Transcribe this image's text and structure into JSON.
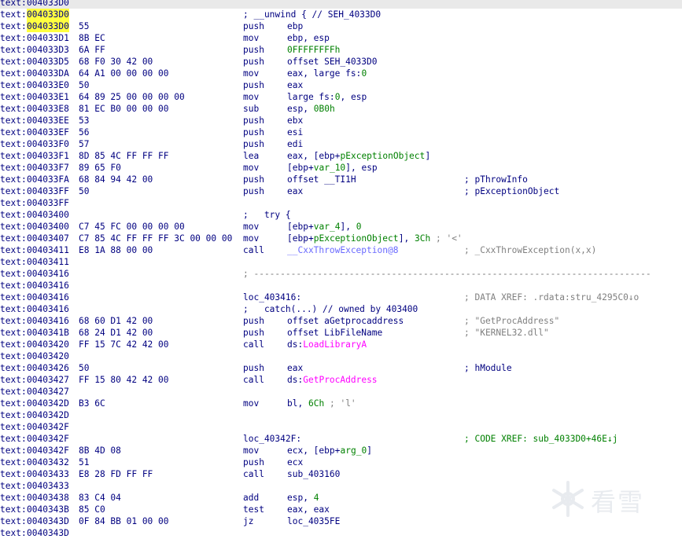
{
  "lines": [
    {
      "seg": "text:",
      "addr": "004033D0",
      "bytes": "",
      "dis": [],
      "right": [],
      "hl": true,
      "mark": false
    },
    {
      "seg": "text:",
      "addr": "004033D0",
      "bytes": "",
      "dis": [
        {
          "t": "; __unwind { // SEH_4033D0",
          "c": "c-mn"
        }
      ],
      "right": [],
      "hl": false,
      "mark": true
    },
    {
      "seg": "text:",
      "addr": "004033D0",
      "bytes": "55",
      "dis": [
        {
          "t": "push",
          "c": "c-mn"
        },
        {
          "t": "ebp",
          "c": "c-op",
          "o": true
        }
      ],
      "right": [],
      "hl": false,
      "mark": true
    },
    {
      "seg": "text:",
      "addr": "004033D1",
      "bytes": "8B EC",
      "dis": [
        {
          "t": "mov",
          "c": "c-mn"
        },
        {
          "t": "ebp, esp",
          "c": "c-op",
          "o": true
        }
      ],
      "right": [],
      "hl": false,
      "mark": false
    },
    {
      "seg": "text:",
      "addr": "004033D3",
      "bytes": "6A FF",
      "dis": [
        {
          "t": "push",
          "c": "c-mn"
        },
        {
          "t": "0FFFFFFFFh",
          "c": "c-num",
          "o": true
        }
      ],
      "right": [],
      "hl": false,
      "mark": false
    },
    {
      "seg": "text:",
      "addr": "004033D5",
      "bytes": "68 F0 30 42 00",
      "dis": [
        {
          "t": "push",
          "c": "c-mn"
        },
        {
          "t": "offset SEH_4033D0",
          "c": "c-op",
          "o": true
        }
      ],
      "right": [],
      "hl": false,
      "mark": false
    },
    {
      "seg": "text:",
      "addr": "004033DA",
      "bytes": "64 A1 00 00 00 00",
      "dis": [
        {
          "t": "mov",
          "c": "c-mn"
        },
        {
          "t": "eax, large fs:",
          "c": "c-op",
          "o": true
        },
        {
          "t": "0",
          "c": "c-num"
        }
      ],
      "right": [],
      "hl": false,
      "mark": false
    },
    {
      "seg": "text:",
      "addr": "004033E0",
      "bytes": "50",
      "dis": [
        {
          "t": "push",
          "c": "c-mn"
        },
        {
          "t": "eax",
          "c": "c-op",
          "o": true
        }
      ],
      "right": [],
      "hl": false,
      "mark": false
    },
    {
      "seg": "text:",
      "addr": "004033E1",
      "bytes": "64 89 25 00 00 00 00",
      "dis": [
        {
          "t": "mov",
          "c": "c-mn"
        },
        {
          "t": "large fs:",
          "c": "c-op",
          "o": true
        },
        {
          "t": "0",
          "c": "c-num"
        },
        {
          "t": ", esp",
          "c": "c-op"
        }
      ],
      "right": [],
      "hl": false,
      "mark": false
    },
    {
      "seg": "text:",
      "addr": "004033E8",
      "bytes": "81 EC B0 00 00 00",
      "dis": [
        {
          "t": "sub",
          "c": "c-mn"
        },
        {
          "t": "esp, ",
          "c": "c-op",
          "o": true
        },
        {
          "t": "0B0h",
          "c": "c-num"
        }
      ],
      "right": [],
      "hl": false,
      "mark": false
    },
    {
      "seg": "text:",
      "addr": "004033EE",
      "bytes": "53",
      "dis": [
        {
          "t": "push",
          "c": "c-mn"
        },
        {
          "t": "ebx",
          "c": "c-op",
          "o": true
        }
      ],
      "right": [],
      "hl": false,
      "mark": false
    },
    {
      "seg": "text:",
      "addr": "004033EF",
      "bytes": "56",
      "dis": [
        {
          "t": "push",
          "c": "c-mn"
        },
        {
          "t": "esi",
          "c": "c-op",
          "o": true
        }
      ],
      "right": [],
      "hl": false,
      "mark": false
    },
    {
      "seg": "text:",
      "addr": "004033F0",
      "bytes": "57",
      "dis": [
        {
          "t": "push",
          "c": "c-mn"
        },
        {
          "t": "edi",
          "c": "c-op",
          "o": true
        }
      ],
      "right": [],
      "hl": false,
      "mark": false
    },
    {
      "seg": "text:",
      "addr": "004033F1",
      "bytes": "8D 85 4C FF FF FF",
      "dis": [
        {
          "t": "lea",
          "c": "c-mn"
        },
        {
          "t": "eax, [ebp+",
          "c": "c-op",
          "o": true
        },
        {
          "t": "pExceptionObject",
          "c": "c-var"
        },
        {
          "t": "]",
          "c": "c-op"
        }
      ],
      "right": [],
      "hl": false,
      "mark": false
    },
    {
      "seg": "text:",
      "addr": "004033F7",
      "bytes": "89 65 F0",
      "dis": [
        {
          "t": "mov",
          "c": "c-mn"
        },
        {
          "t": "[ebp+",
          "c": "c-op",
          "o": true
        },
        {
          "t": "var_10",
          "c": "c-var"
        },
        {
          "t": "], esp",
          "c": "c-op"
        }
      ],
      "right": [],
      "hl": false,
      "mark": false
    },
    {
      "seg": "text:",
      "addr": "004033FA",
      "bytes": "68 84 94 42 00",
      "dis": [
        {
          "t": "push",
          "c": "c-mn"
        },
        {
          "t": "offset __TI1H",
          "c": "c-op",
          "o": true
        }
      ],
      "right": [
        {
          "t": "; pThrowInfo",
          "c": "c-xref"
        }
      ],
      "hl": false,
      "mark": false
    },
    {
      "seg": "text:",
      "addr": "004033FF",
      "bytes": "50",
      "dis": [
        {
          "t": "push",
          "c": "c-mn"
        },
        {
          "t": "eax",
          "c": "c-op",
          "o": true
        }
      ],
      "right": [
        {
          "t": "; pExceptionObject",
          "c": "c-xref"
        }
      ],
      "hl": false,
      "mark": false
    },
    {
      "seg": "text:",
      "addr": "004033FF",
      "bytes": "",
      "dis": [],
      "right": [],
      "hl": false,
      "mark": false
    },
    {
      "seg": "text:",
      "addr": "00403400",
      "bytes": "",
      "dis": [
        {
          "t": ";   try {",
          "c": "c-kw"
        }
      ],
      "right": [],
      "hl": false,
      "mark": false
    },
    {
      "seg": "text:",
      "addr": "00403400",
      "bytes": "C7 45 FC 00 00 00 00",
      "dis": [
        {
          "t": "mov",
          "c": "c-mn"
        },
        {
          "t": "[ebp+",
          "c": "c-op",
          "o": true
        },
        {
          "t": "var_4",
          "c": "c-var"
        },
        {
          "t": "], ",
          "c": "c-op"
        },
        {
          "t": "0",
          "c": "c-num"
        }
      ],
      "right": [],
      "hl": false,
      "mark": false
    },
    {
      "seg": "text:",
      "addr": "00403407",
      "bytes": "C7 85 4C FF FF FF 3C 00 00 00",
      "dis": [
        {
          "t": "mov",
          "c": "c-mn"
        },
        {
          "t": "[ebp+",
          "c": "c-op",
          "o": true
        },
        {
          "t": "pExceptionObject",
          "c": "c-var"
        },
        {
          "t": "], ",
          "c": "c-op"
        },
        {
          "t": "3Ch",
          "c": "c-num"
        },
        {
          "t": " ; '<'",
          "c": "c-cmt"
        }
      ],
      "right": [],
      "hl": false,
      "mark": false
    },
    {
      "seg": "text:",
      "addr": "00403411",
      "bytes": "E8 1A 88 00 00",
      "dis": [
        {
          "t": "call",
          "c": "c-mn"
        },
        {
          "t": "__CxxThrowException@8",
          "c": "c-ext",
          "o": true
        }
      ],
      "right": [
        {
          "t": "; _CxxThrowException(x,x)",
          "c": "c-cmt"
        }
      ],
      "hl": false,
      "mark": false
    },
    {
      "seg": "text:",
      "addr": "00403411",
      "bytes": "",
      "dis": [],
      "right": [],
      "hl": false,
      "mark": false
    },
    {
      "seg": "text:",
      "addr": "00403416",
      "bytes": "",
      "dis": [
        {
          "t": "; ---------------------------------------------------------------------------",
          "c": "c-dash"
        }
      ],
      "right": [],
      "hl": false,
      "mark": false
    },
    {
      "seg": "text:",
      "addr": "00403416",
      "bytes": "",
      "dis": [],
      "right": [],
      "hl": false,
      "mark": false
    },
    {
      "seg": "text:",
      "addr": "00403416",
      "bytes": "",
      "dis": [
        {
          "t": "loc_403416:",
          "c": "c-mn"
        }
      ],
      "right": [
        {
          "t": "; DATA XREF: .rdata:stru_4295C0↓o",
          "c": "c-cmt"
        }
      ],
      "hl": false,
      "mark": false
    },
    {
      "seg": "text:",
      "addr": "00403416",
      "bytes": "",
      "dis": [
        {
          "t": ";   catch(...) // owned by 403400",
          "c": "c-kw"
        }
      ],
      "right": [],
      "hl": false,
      "mark": false
    },
    {
      "seg": "text:",
      "addr": "00403416",
      "bytes": "68 60 D1 42 00",
      "dis": [
        {
          "t": "push",
          "c": "c-mn"
        },
        {
          "t": "offset aGetprocaddress",
          "c": "c-op",
          "o": true
        }
      ],
      "right": [
        {
          "t": "; \"GetProcAddress\"",
          "c": "c-cmt"
        }
      ],
      "hl": false,
      "mark": false
    },
    {
      "seg": "text:",
      "addr": "0040341B",
      "bytes": "68 24 D1 42 00",
      "dis": [
        {
          "t": "push",
          "c": "c-mn"
        },
        {
          "t": "offset LibFileName",
          "c": "c-op",
          "o": true
        }
      ],
      "right": [
        {
          "t": "; \"KERNEL32.dll\"",
          "c": "c-cmt"
        }
      ],
      "hl": false,
      "mark": false
    },
    {
      "seg": "text:",
      "addr": "00403420",
      "bytes": "FF 15 7C 42 42 00",
      "dis": [
        {
          "t": "call",
          "c": "c-mn"
        },
        {
          "t": "ds:",
          "c": "c-op",
          "o": true
        },
        {
          "t": "LoadLibraryA",
          "c": "c-imp"
        }
      ],
      "right": [],
      "hl": false,
      "mark": false
    },
    {
      "seg": "text:",
      "addr": "00403420",
      "bytes": "",
      "dis": [],
      "right": [],
      "hl": false,
      "mark": false
    },
    {
      "seg": "text:",
      "addr": "00403426",
      "bytes": "50",
      "dis": [
        {
          "t": "push",
          "c": "c-mn"
        },
        {
          "t": "eax",
          "c": "c-op",
          "o": true
        }
      ],
      "right": [
        {
          "t": "; hModule",
          "c": "c-xref"
        }
      ],
      "hl": false,
      "mark": false
    },
    {
      "seg": "text:",
      "addr": "00403427",
      "bytes": "FF 15 80 42 42 00",
      "dis": [
        {
          "t": "call",
          "c": "c-mn"
        },
        {
          "t": "ds:",
          "c": "c-op",
          "o": true
        },
        {
          "t": "GetProcAddress",
          "c": "c-imp"
        }
      ],
      "right": [],
      "hl": false,
      "mark": false
    },
    {
      "seg": "text:",
      "addr": "00403427",
      "bytes": "",
      "dis": [],
      "right": [],
      "hl": false,
      "mark": false
    },
    {
      "seg": "text:",
      "addr": "0040342D",
      "bytes": "B3 6C",
      "dis": [
        {
          "t": "mov",
          "c": "c-mn"
        },
        {
          "t": "bl, ",
          "c": "c-op",
          "o": true
        },
        {
          "t": "6Ch",
          "c": "c-num"
        },
        {
          "t": " ; 'l'",
          "c": "c-cmt"
        }
      ],
      "right": [],
      "hl": false,
      "mark": false
    },
    {
      "seg": "text:",
      "addr": "0040342D",
      "bytes": "",
      "dis": [],
      "right": [],
      "hl": false,
      "mark": false
    },
    {
      "seg": "text:",
      "addr": "0040342F",
      "bytes": "",
      "dis": [],
      "right": [],
      "hl": false,
      "mark": false
    },
    {
      "seg": "text:",
      "addr": "0040342F",
      "bytes": "",
      "dis": [
        {
          "t": "loc_40342F:",
          "c": "c-mn"
        }
      ],
      "right": [
        {
          "t": "; CODE XREF: sub_4033D0+46E↓j",
          "c": "c-num"
        }
      ],
      "hl": false,
      "mark": false
    },
    {
      "seg": "text:",
      "addr": "0040342F",
      "bytes": "8B 4D 08",
      "dis": [
        {
          "t": "mov",
          "c": "c-mn"
        },
        {
          "t": "ecx, [ebp+",
          "c": "c-op",
          "o": true
        },
        {
          "t": "arg_0",
          "c": "c-var"
        },
        {
          "t": "]",
          "c": "c-op"
        }
      ],
      "right": [],
      "hl": false,
      "mark": false
    },
    {
      "seg": "text:",
      "addr": "00403432",
      "bytes": "51",
      "dis": [
        {
          "t": "push",
          "c": "c-mn"
        },
        {
          "t": "ecx",
          "c": "c-op",
          "o": true
        }
      ],
      "right": [],
      "hl": false,
      "mark": false
    },
    {
      "seg": "text:",
      "addr": "00403433",
      "bytes": "E8 28 FD FF FF",
      "dis": [
        {
          "t": "call",
          "c": "c-mn"
        },
        {
          "t": "sub_403160",
          "c": "c-op",
          "o": true
        }
      ],
      "right": [],
      "hl": false,
      "mark": false
    },
    {
      "seg": "text:",
      "addr": "00403433",
      "bytes": "",
      "dis": [],
      "right": [],
      "hl": false,
      "mark": false
    },
    {
      "seg": "text:",
      "addr": "00403438",
      "bytes": "83 C4 04",
      "dis": [
        {
          "t": "add",
          "c": "c-mn"
        },
        {
          "t": "esp, ",
          "c": "c-op",
          "o": true
        },
        {
          "t": "4",
          "c": "c-num"
        }
      ],
      "right": [],
      "hl": false,
      "mark": false
    },
    {
      "seg": "text:",
      "addr": "0040343B",
      "bytes": "85 C0",
      "dis": [
        {
          "t": "test",
          "c": "c-mn"
        },
        {
          "t": "eax, eax",
          "c": "c-op",
          "o": true
        }
      ],
      "right": [],
      "hl": false,
      "mark": false
    },
    {
      "seg": "text:",
      "addr": "0040343D",
      "bytes": "0F 84 BB 01 00 00",
      "dis": [
        {
          "t": "jz",
          "c": "c-mn"
        },
        {
          "t": "loc_4035FE",
          "c": "c-op",
          "o": true
        }
      ],
      "right": [],
      "hl": false,
      "mark": false
    },
    {
      "seg": "text:",
      "addr": "0040343D",
      "bytes": "",
      "dis": [],
      "right": [],
      "hl": false,
      "mark": false
    }
  ],
  "watermark": {
    "text": "看雪",
    "icon": "snowflake-icon"
  },
  "colors": {
    "address": "#000080",
    "highlight": "#ffff40",
    "number": "#008000",
    "import": "#ff00ff",
    "comment": "#808080"
  }
}
